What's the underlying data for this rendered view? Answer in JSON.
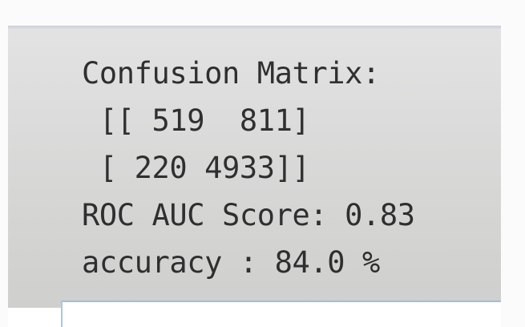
{
  "output": {
    "heading": "Confusion Matrix:",
    "matrix_row_1": " [[ 519  811]",
    "matrix_row_2": " [ 220 4933]]",
    "roc_auc": "ROC AUC Score: 0.83",
    "accuracy": "accuracy : 84.0 %"
  }
}
